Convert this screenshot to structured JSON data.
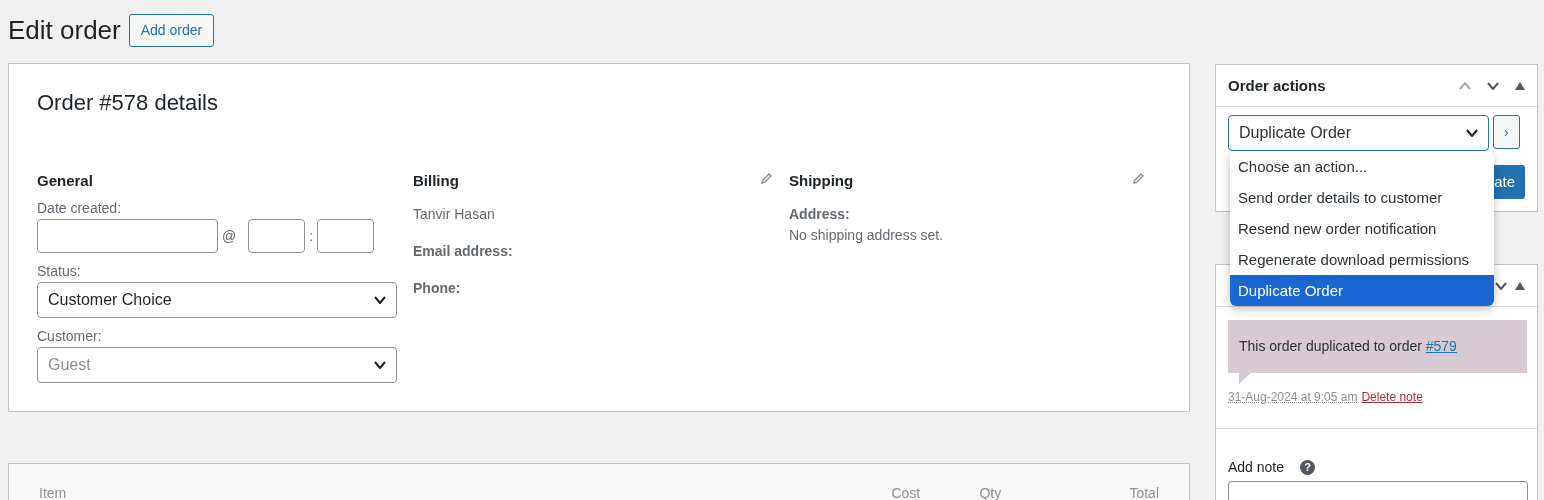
{
  "page_title": "Edit order",
  "add_button": "Add order",
  "order": {
    "title": "Order #578 details",
    "general": {
      "heading": "General",
      "date_label": "Date created:",
      "at": "@",
      "colon": ":",
      "status_label": "Status:",
      "status_value": "Customer Choice",
      "customer_label": "Customer:",
      "customer_placeholder": "Guest"
    },
    "billing": {
      "heading": "Billing",
      "name": "Tanvir Hasan",
      "email_label": "Email address:",
      "phone_label": "Phone:"
    },
    "shipping": {
      "heading": "Shipping",
      "address_label": "Address:",
      "address_value": "No shipping address set."
    }
  },
  "items_table": {
    "columns": [
      "Item",
      "Cost",
      "Qty",
      "Total"
    ]
  },
  "order_actions": {
    "title": "Order actions",
    "selected_action": "Duplicate Order",
    "apply": "›",
    "update_button": "ate",
    "dropdown": [
      {
        "label": "Choose an action...",
        "selected": false
      },
      {
        "label": "Send order details to customer",
        "selected": false
      },
      {
        "label": "Resend new order notification",
        "selected": false
      },
      {
        "label": "Regenerate download permissions",
        "selected": false
      },
      {
        "label": "Duplicate Order",
        "selected": true
      }
    ]
  },
  "notes": {
    "items": [
      {
        "text": "This order duplicated to order",
        "link": "#579",
        "date": "31-Aug-2024 at 9:05 am",
        "delete": "Delete note"
      }
    ],
    "add_label": "Add note",
    "help": "?"
  }
}
